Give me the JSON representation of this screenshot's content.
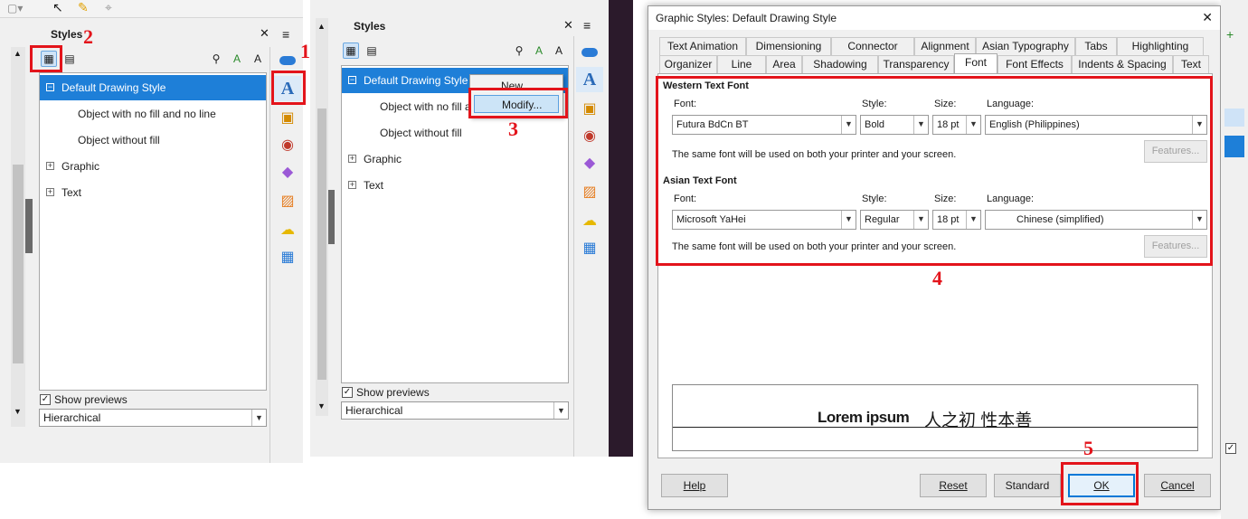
{
  "panel_a": {
    "title": "Styles",
    "items": [
      {
        "label": "Default Drawing Style",
        "selected": true,
        "expander": "−"
      },
      {
        "label": "Object with no fill and no line"
      },
      {
        "label": "Object without fill"
      },
      {
        "label": "Graphic",
        "expander": "+"
      },
      {
        "label": "Text",
        "expander": "+"
      }
    ],
    "show_previews": "Show previews",
    "filter": "Hierarchical"
  },
  "panel_b": {
    "title": "Styles",
    "items": [
      {
        "label": "Default Drawing Style",
        "selected": true,
        "expander": "−"
      },
      {
        "label": "Object with no fill and no line"
      },
      {
        "label": "Object without fill"
      },
      {
        "label": "Graphic",
        "expander": "+"
      },
      {
        "label": "Text",
        "expander": "+"
      }
    ],
    "context_menu": {
      "new": "New...",
      "modify": "Modify..."
    },
    "show_previews": "Show previews",
    "filter": "Hierarchical"
  },
  "dialog": {
    "title": "Graphic Styles: Default Drawing Style",
    "close": "✕",
    "tabs_row1": [
      "Text Animation",
      "Dimensioning",
      "Connector",
      "Alignment",
      "Asian Typography",
      "Tabs",
      "Highlighting"
    ],
    "tabs_row2": [
      "Organizer",
      "Line",
      "Area",
      "Shadowing",
      "Transparency",
      "Font",
      "Font Effects",
      "Indents & Spacing",
      "Text"
    ],
    "active_tab": "Font",
    "western": {
      "heading": "Western Text Font",
      "font_label": "Font:",
      "font": "Futura BdCn BT",
      "style_label": "Style:",
      "style": "Bold",
      "size_label": "Size:",
      "size": "18 pt",
      "language_label": "Language:",
      "language": "English (Philippines)",
      "note": "The same font will be used on both your printer and your screen.",
      "features": "Features..."
    },
    "asian": {
      "heading": "Asian Text Font",
      "font_label": "Font:",
      "font": "Microsoft YaHei",
      "style_label": "Style:",
      "style": "Regular",
      "size_label": "Size:",
      "size": "18 pt",
      "language_label": "Language:",
      "language": "Chinese (simplified)",
      "note": "The same font will be used on both your printer and your screen.",
      "features": "Features..."
    },
    "preview": {
      "western": "Lorem ipsum",
      "asian": "人之初 性本善"
    },
    "buttons": {
      "help": "Help",
      "reset": "Reset",
      "standard": "Standard",
      "ok": "OK",
      "cancel": "Cancel"
    }
  },
  "callouts": [
    "1",
    "2",
    "3",
    "4",
    "5"
  ],
  "colors": {
    "selection": "#1e7fd8",
    "callout": "#e3141b",
    "default_button": "#0078d7"
  }
}
